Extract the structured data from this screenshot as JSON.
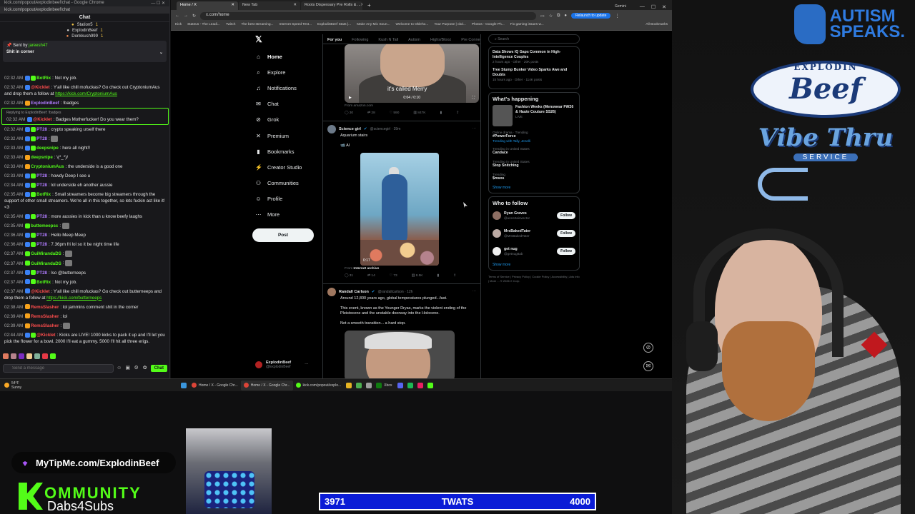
{
  "chat": {
    "window_title": "kick.com/popout/explodinbeef/chat - Google Chrome",
    "url": "kick.com/popout/explodinbeef/chat",
    "header": "Chat",
    "leaderboard": [
      {
        "name": "Station5",
        "count": "1",
        "rank": "gold"
      },
      {
        "name": "ExplodinBeef",
        "count": "1",
        "rank": "silver"
      },
      {
        "name": "Donkkush999",
        "count": "1",
        "rank": "bronze"
      }
    ],
    "pinned": {
      "sent_by_label": "Sent by",
      "sent_by_user": "jareesh47",
      "text": "Shit in corner"
    },
    "messages": [
      {
        "time": "02:32 AM",
        "user": "BotRix",
        "color": "#53fc18",
        "text": "Not my job.",
        "badges": "bg"
      },
      {
        "time": "02:32 AM",
        "user": "@Kicklet",
        "color": "#ff4d4d",
        "text": "Y'all like chill mofuckas? Go check out CryptoniumAus and drop them a follow at ",
        "link": "https://kick.com/CryptoniumAus",
        "badges": "b"
      },
      {
        "time": "02:32 AM",
        "user": "ExplodinBeef",
        "color": "#b07cff",
        "text": "!badges",
        "badges": "o"
      },
      {
        "reply": "Replying to ExplodinBeef: !badges",
        "time": "02:32 AM",
        "user": "@Kicklet",
        "color": "#ff4d4d",
        "text": "Badges Motherfucker! Do you wear them?",
        "badges": "b",
        "highlight": true
      },
      {
        "time": "02:32 AM",
        "user": "PT28",
        "color": "#b07cff",
        "text": "crypto speaking urself there",
        "badges": "bg"
      },
      {
        "time": "02:32 AM",
        "user": "PT28",
        "color": "#b07cff",
        "text": ":emote:",
        "badges": "bg"
      },
      {
        "time": "02:33 AM",
        "user": "deepsnipe",
        "color": "#53fc18",
        "text": "here all night!!",
        "badges": "bg"
      },
      {
        "time": "02:33 AM",
        "user": "deepsnipe",
        "color": "#53fc18",
        "text": "\\(*_*)/",
        "badges": "o"
      },
      {
        "time": "02:33 AM",
        "user": "CryptoniumAus",
        "color": "#53fc18",
        "text": "the underside is a good one",
        "badges": "o"
      },
      {
        "time": "02:33 AM",
        "user": "PT28",
        "color": "#b07cff",
        "text": "howdy Deep I see u",
        "badges": "bg"
      },
      {
        "time": "02:34 AM",
        "user": "PT28",
        "color": "#b07cff",
        "text": "lol underside eh another aussie",
        "badges": "bg"
      },
      {
        "time": "02:35 AM",
        "user": "BotRix",
        "color": "#53fc18",
        "text": "Small streamers become big streamers through the support of other small streamers. We're all in this together, so lets fuckin act like it! <3",
        "badges": "bg"
      },
      {
        "time": "02:35 AM",
        "user": "PT28",
        "color": "#b07cff",
        "text": "more aussies in kick than u know beefy laughs",
        "badges": "bg"
      },
      {
        "time": "02:35 AM",
        "user": "buttemeepsc",
        "color": "#53fc18",
        "text": ":emote:",
        "badges": "g"
      },
      {
        "time": "02:36 AM",
        "user": "PT28",
        "color": "#b07cff",
        "text": "Hello Meep Meep",
        "badges": "bg"
      },
      {
        "time": "02:36 AM",
        "user": "PT28",
        "color": "#b07cff",
        "text": "7.36pm fri lol so it be night time life",
        "badges": "bg"
      },
      {
        "time": "02:37 AM",
        "user": "GuiMirandaDS",
        "color": "#53fc18",
        "text": ":emote:",
        "badges": "g"
      },
      {
        "time": "02:37 AM",
        "user": "GuiMirandaDS",
        "color": "#53fc18",
        "text": ":emote:",
        "badges": "g"
      },
      {
        "time": "02:37 AM",
        "user": "PT28",
        "color": "#b07cff",
        "text": "lso @butterneeps",
        "badges": "bg"
      },
      {
        "time": "02:37 AM",
        "user": "BotRix",
        "color": "#53fc18",
        "text": "Not my job.",
        "badges": "bg"
      },
      {
        "time": "02:37 AM",
        "user": "@Kicklet",
        "color": "#ff4d4d",
        "text": "Y'all like chill mofuckas? Go check out butterneeps and drop them a follow at ",
        "link": "https://kick.com/butterneeps",
        "badges": "b"
      },
      {
        "time": "02:38 AM",
        "user": "RemsSlasher",
        "color": "#ff4d4d",
        "text": "lol jammins comment shit in the corner",
        "badges": "o"
      },
      {
        "time": "02:39 AM",
        "user": "RemsSlasher",
        "color": "#ff4d4d",
        "text": "lol",
        "badges": "o"
      },
      {
        "time": "02:39 AM",
        "user": "RemsSlasher",
        "color": "#ff4d4d",
        "text": ":emote:",
        "badges": "o"
      },
      {
        "time": "02:44 AM",
        "user": "@Kicklet",
        "color": "#ff4d4d",
        "text": "Kicks are LIVE! 1000 kicks to pack it up and I'll let you pick the flower for a bowl. 2000 I'll eat a gummy. 5000 I'll hit all three erigs.",
        "badges": "bg"
      }
    ],
    "input_placeholder": "Send a message",
    "send_label": "Chat",
    "emote_colors": [
      "#e07a5f",
      "#b5838d",
      "#7b2cbf",
      "#f2cc8f",
      "#81b29a",
      "#e63946",
      "#53fc18"
    ]
  },
  "browser": {
    "tabs": [
      {
        "label": "Home / X",
        "active": true
      },
      {
        "label": "New Tab",
        "active": false
      },
      {
        "label": "Roots Dispensary Pre Rolls & ...",
        "active": false
      }
    ],
    "gemini_label": "Gemini",
    "url": "x.com/home",
    "relaunch_label": "Relaunch to update",
    "bookmarks": [
      "Kick",
      "Stateus - The Leadi...",
      "Twitch",
      "The best streaming...",
      "Internet Speed Test...",
      "ExplodinBeef Stats |...",
      "Make Any Mic Soun...",
      "Welcome to Okleho...",
      "Your Purpose | cbd...",
      "Photos - Google Ph...",
      "Fix gaming issues w..."
    ],
    "all_bookmarks": "All Bookmarks"
  },
  "x": {
    "nav": [
      {
        "label": "Home",
        "icon": "home-icon",
        "glyph": "⌂",
        "active": true
      },
      {
        "label": "Explore",
        "icon": "search-icon",
        "glyph": "⌕"
      },
      {
        "label": "Notifications",
        "icon": "bell-icon",
        "glyph": "♫"
      },
      {
        "label": "Chat",
        "icon": "mail-icon",
        "glyph": "✉"
      },
      {
        "label": "Grok",
        "icon": "grok-icon",
        "glyph": "⊘"
      },
      {
        "label": "Premium",
        "icon": "x-icon",
        "glyph": "✕"
      },
      {
        "label": "Bookmarks",
        "icon": "bookmark-icon",
        "glyph": "▮"
      },
      {
        "label": "Creator Studio",
        "icon": "bolt-icon",
        "glyph": "⚡"
      },
      {
        "label": "Communities",
        "icon": "people-icon",
        "glyph": "⚇"
      },
      {
        "label": "Profile",
        "icon": "person-icon",
        "glyph": "☺"
      },
      {
        "label": "More",
        "icon": "more-icon",
        "glyph": "⋯"
      }
    ],
    "post_label": "Post",
    "profile": {
      "name": "ExplodinBeef",
      "handle": "@ExplodinBeef"
    },
    "feed_tabs": [
      "For you",
      "Following",
      "Kush N Tall",
      "Autism",
      "Highs/Blooz",
      "Pre Connect"
    ],
    "tweet0": {
      "video_caption": "it's called Merry",
      "video_time": "0:04 / 0:10",
      "from": "From amazon.com",
      "stats": [
        "30",
        "28",
        "590",
        "847K"
      ]
    },
    "tweet1": {
      "name": "Science girl",
      "handle": "@sciencegirl · 39m",
      "text": "Aquarium stairs",
      "sub": "📹 AI",
      "duration": "0:17",
      "from_label": "From",
      "from_source": "Internet archive",
      "stats": [
        "31",
        "14",
        "73",
        "8.5K"
      ]
    },
    "tweet2": {
      "name": "Randall Carlson",
      "handle": "@randallcarlson · 12h",
      "line1": "Around 12,800 years ago, global temperatures plunged...fast.",
      "line2": "This event, known as the Younger Dryas, marks the violent ending of the Pleistocene and the unstable doorway into the Holocene.",
      "line3": "Not a smooth transition... a hard stop."
    },
    "search_placeholder": "Search",
    "trends_top": [
      {
        "big": "Data Shows IQ Gaps Common in High-Intelligence Couples",
        "small": "2 hours ago · Other · 20K posts"
      },
      {
        "big": "Tree Stump Bunker Video Sparks Awe and Doubts",
        "small": "15 hours ago · Other · 114K posts"
      }
    ],
    "happening_title": "What's happening",
    "happening_feature": {
      "big": "Fashion Weeks (Menswear FW26 & Haute Couture SS26)",
      "small": "LIVE"
    },
    "happening_trends": [
      {
        "small": "Online drama · Trending",
        "big": "#PowerForce",
        "link": "Trending with Tally, Jenelli"
      },
      {
        "small": "Trending in United States",
        "big": "Candace"
      },
      {
        "small": "Trending in United States",
        "big": "Stop Snitching"
      },
      {
        "small": "Trending",
        "big": "$msos"
      }
    ],
    "show_more": "Show more",
    "who_to_follow_title": "Who to follow",
    "who_to_follow": [
      {
        "name": "Ryan Graves",
        "handle": "@uncertainvector"
      },
      {
        "name": "MrsBakedTater",
        "handle": "@MrsBakedTater"
      },
      {
        "name": "get nug",
        "handle": "@getnug8ab"
      }
    ],
    "follow_label": "Follow",
    "footer": "Terms of Service | Privacy Policy | Cookie Policy | Accessibility | Ads info | More ... © 2026 X Corp."
  },
  "taskbar": {
    "weather_temp": "54°F",
    "weather_desc": "Sunny",
    "apps": [
      {
        "label": "Home / X - Google Chr...",
        "active": false
      },
      {
        "label": "Home / X - Google Chr...",
        "active": true
      },
      {
        "label": "kick.com/popout/explo...",
        "active": false
      }
    ],
    "extra_icon_colors": [
      "#e6b422",
      "#4caf50",
      "#9e9e9e",
      "#107c10",
      "#5865f2",
      "#1db954",
      "#e91e63",
      "#53fc18"
    ],
    "xbox_label": "Xbox"
  },
  "overlay": {
    "autism_line1": "AUTISM",
    "autism_line2": "SPEAKS.",
    "beef_word1": "EXPLODIN",
    "beef_word2": "Beef",
    "beef_word3": "Vibe Thru",
    "beef_word4": "SERVICE",
    "tipme": "MyTipMe.com/ExplodinBeef",
    "kommunity_line1": "OMMUNITY",
    "kommunity_line2": "Dabs4Subs",
    "goal": {
      "current": "3971",
      "label": "TWATS",
      "target": "4000",
      "progress": 0.9928
    }
  }
}
